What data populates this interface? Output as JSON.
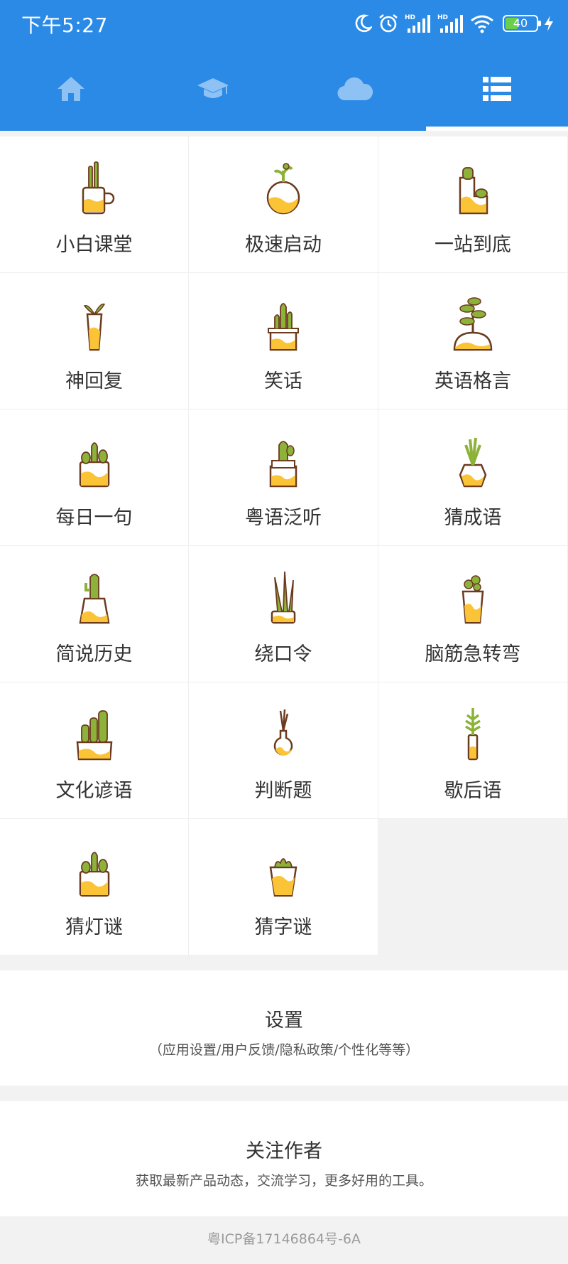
{
  "status_bar": {
    "time": "下午5:27",
    "battery_level": "40",
    "battery_fraction": 0.4,
    "icons": [
      "moon-icon",
      "alarm-icon",
      "hd-signal-icon",
      "hd-signal-icon",
      "wifi-icon",
      "battery-icon",
      "charging-icon"
    ]
  },
  "tabs": [
    {
      "icon": "home-icon",
      "active": false
    },
    {
      "icon": "graduation-cap-icon",
      "active": false
    },
    {
      "icon": "cloud-icon",
      "active": false
    },
    {
      "icon": "list-icon",
      "active": true
    }
  ],
  "grid": {
    "items": [
      {
        "label": "小白课堂",
        "icon": "cactus-mug-icon"
      },
      {
        "label": "极速启动",
        "icon": "round-vase-plant-icon"
      },
      {
        "label": "一站到底",
        "icon": "cactus-step-pot-icon"
      },
      {
        "label": "神回复",
        "icon": "sprout-vase-icon"
      },
      {
        "label": "笑话",
        "icon": "cactus-box-pot-icon"
      },
      {
        "label": "英语格言",
        "icon": "bonsai-tree-icon"
      },
      {
        "label": "每日一句",
        "icon": "cactus-square-pot-icon"
      },
      {
        "label": "粤语泛听",
        "icon": "cactus-stacked-pot-icon"
      },
      {
        "label": "猜成语",
        "icon": "grass-hex-pot-icon"
      },
      {
        "label": "简说历史",
        "icon": "saguaro-pot-icon"
      },
      {
        "label": "绕口令",
        "icon": "aloe-pot-icon"
      },
      {
        "label": "脑筋急转弯",
        "icon": "clover-jar-icon"
      },
      {
        "label": "文化谚语",
        "icon": "cacti-group-pot-icon"
      },
      {
        "label": "判断题",
        "icon": "bulb-vase-icon"
      },
      {
        "label": "歇后语",
        "icon": "tall-succulent-icon"
      },
      {
        "label": "猜灯谜",
        "icon": "cactus-square-pot-icon"
      },
      {
        "label": "猜字谜",
        "icon": "succulent-cup-icon"
      }
    ]
  },
  "settings": {
    "title": "设置",
    "subtitle": "（应用设置/用户反馈/隐私政策/个性化等等）"
  },
  "follow": {
    "title": "关注作者",
    "subtitle": "获取最新产品动态，交流学习，更多好用的工具。"
  },
  "footer": {
    "icp": "粤ICP备17146864号-6A"
  },
  "colors": {
    "header_blue": "#2a8ae6",
    "tab_icon": "#8ec2f5",
    "tab_icon_active": "#ffffff",
    "pot_yellow": "#fbc437",
    "plant_green": "#8cb23a",
    "outline": "#6b3b1f"
  }
}
